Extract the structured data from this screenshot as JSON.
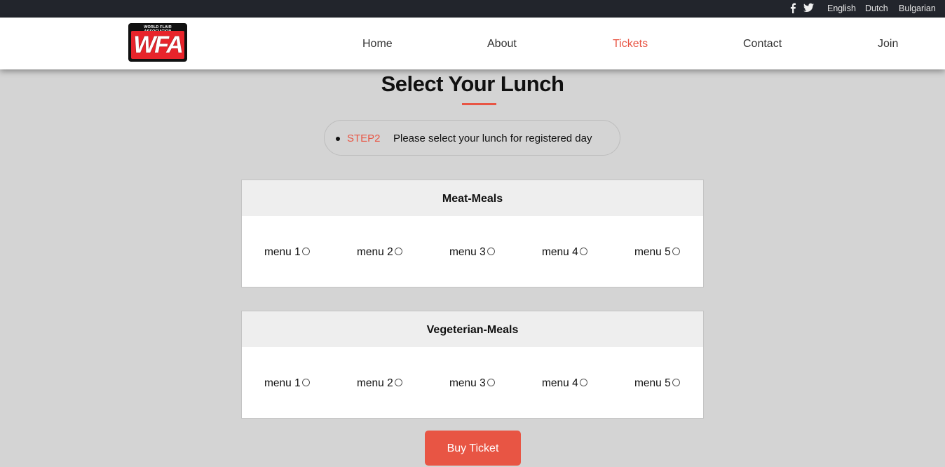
{
  "topbar": {
    "social": [
      "facebook-icon",
      "twitter-icon"
    ],
    "languages": [
      "English",
      "Dutch",
      "Bulgarian"
    ]
  },
  "brand": {
    "logo_tagline": "WORLD FLAIR ASSOCIATION",
    "logo_letters": "WFA"
  },
  "nav": {
    "items": [
      "Home",
      "About",
      "Tickets",
      "Contact",
      "Join"
    ],
    "active": "Tickets"
  },
  "page": {
    "title": "Select Your Lunch"
  },
  "step": {
    "label": "STEP2",
    "text": "Please select your lunch for registered day"
  },
  "meals": [
    {
      "title": "Meat-Meals",
      "options": [
        "menu 1",
        "menu 2",
        "menu 3",
        "menu 4",
        "menu 5"
      ]
    },
    {
      "title": "Vegeterian-Meals",
      "options": [
        "menu 1",
        "menu 2",
        "menu 3",
        "menu 4",
        "menu 5"
      ]
    }
  ],
  "actions": {
    "buy_label": "Buy Ticket"
  },
  "colors": {
    "accent": "#e85544",
    "topbar_bg": "#22252c",
    "page_bg": "#d4d4d4"
  }
}
